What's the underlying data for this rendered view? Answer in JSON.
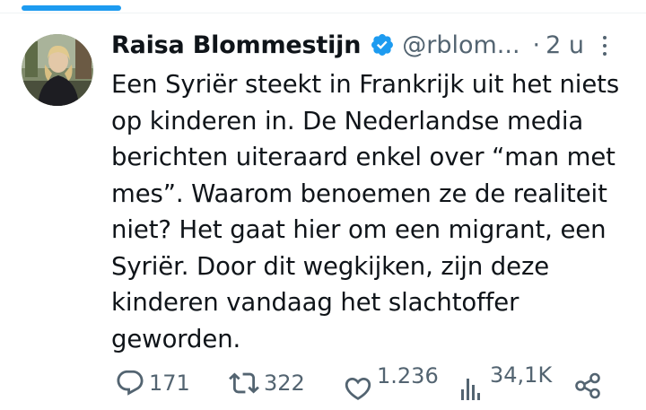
{
  "tweet": {
    "author": {
      "display_name": "Raisa Blommestijn",
      "handle": "@rblom...",
      "verified": true,
      "verified_color": "#1d9bf0"
    },
    "separator": "·",
    "time": "2 u",
    "text_lines": [
      "Een Syriër steekt in Frankrijk uit het niets",
      "op kinderen in. De Nederlandse media",
      "berichten uiteraard enkel over “man met",
      "mes”. Waarom benoemen ze de realiteit",
      "niet? Het gaat hier om een migrant, een",
      "Syriër. Door dit wegkijken, zijn deze",
      "kinderen vandaag het slachtoffer",
      "geworden."
    ],
    "actions": {
      "reply": {
        "icon": "reply-icon",
        "count": "171"
      },
      "retweet": {
        "icon": "retweet-icon",
        "count": "322"
      },
      "like": {
        "icon": "heart-icon",
        "count": "1.236"
      },
      "views": {
        "icon": "views-icon",
        "count": "34,1K"
      },
      "share": {
        "icon": "share-icon"
      }
    }
  },
  "colors": {
    "text": "#0f1419",
    "secondary": "#536471",
    "accent": "#1d9bf0",
    "divider": "#eff3f4"
  }
}
